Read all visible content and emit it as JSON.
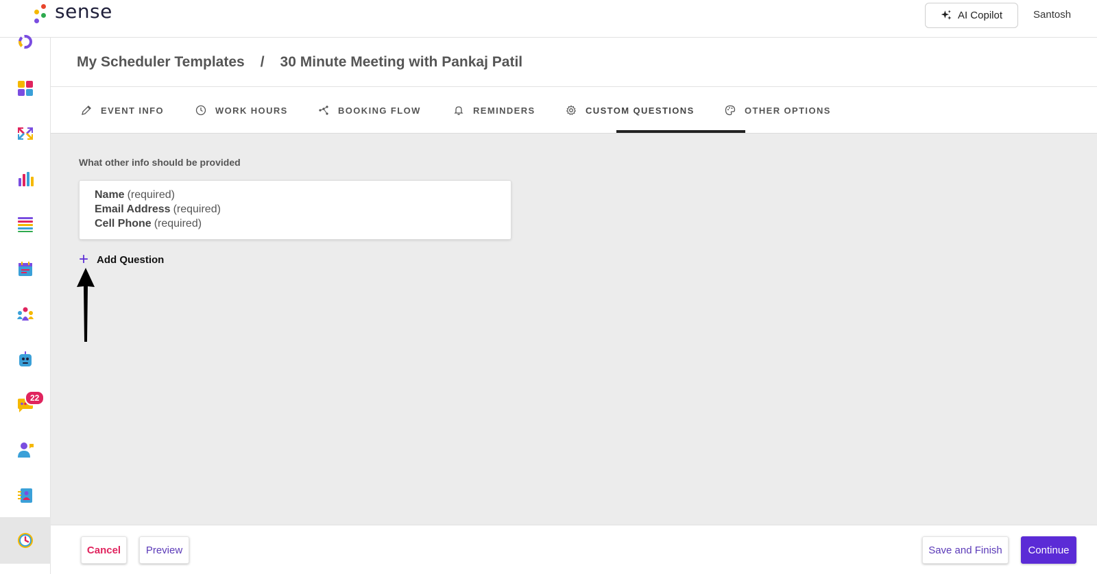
{
  "app": {
    "logo_text": "sense",
    "copilot_label": "AI Copilot",
    "user_name": "Santosh"
  },
  "sidebar": {
    "items": [
      {
        "icon": "loading-ring-icon"
      },
      {
        "icon": "dashboard-grid-icon"
      },
      {
        "icon": "arrows-exchange-icon"
      },
      {
        "icon": "bar-chart-icon"
      },
      {
        "icon": "list-icon"
      },
      {
        "icon": "calendar-icon"
      },
      {
        "icon": "team-icon"
      },
      {
        "icon": "bot-icon"
      },
      {
        "icon": "chat-icon",
        "badge": "22"
      },
      {
        "icon": "user-chat-icon"
      },
      {
        "icon": "contacts-icon"
      },
      {
        "icon": "scheduler-clock-icon",
        "active": true
      }
    ],
    "chat_badge": "22"
  },
  "breadcrumb": {
    "parent": "My Scheduler Templates",
    "separator": "/",
    "current": "30 Minute Meeting with Pankaj Patil"
  },
  "tabs": [
    {
      "label": "EVENT INFO",
      "icon": "pencil-icon"
    },
    {
      "label": "WORK HOURS",
      "icon": "clock-icon"
    },
    {
      "label": "BOOKING FLOW",
      "icon": "flow-icon"
    },
    {
      "label": "REMINDERS",
      "icon": "bell-icon"
    },
    {
      "label": "CUSTOM QUESTIONS",
      "icon": "gear-icon",
      "active": true
    },
    {
      "label": "OTHER OPTIONS",
      "icon": "palette-icon"
    }
  ],
  "main": {
    "section_label": "What other info should be provided",
    "questions": [
      {
        "name": "Name",
        "suffix": "(required)"
      },
      {
        "name": "Email Address",
        "suffix": "(required)"
      },
      {
        "name": "Cell Phone",
        "suffix": "(required)"
      }
    ],
    "add_question_label": "Add Question",
    "add_question_icon": "+"
  },
  "footer": {
    "cancel_label": "Cancel",
    "preview_label": "Preview",
    "save_finish_label": "Save and Finish",
    "continue_label": "Continue"
  },
  "colors": {
    "accent": "#5b2bd6",
    "danger": "#e0245e",
    "content_bg": "#ececec"
  }
}
